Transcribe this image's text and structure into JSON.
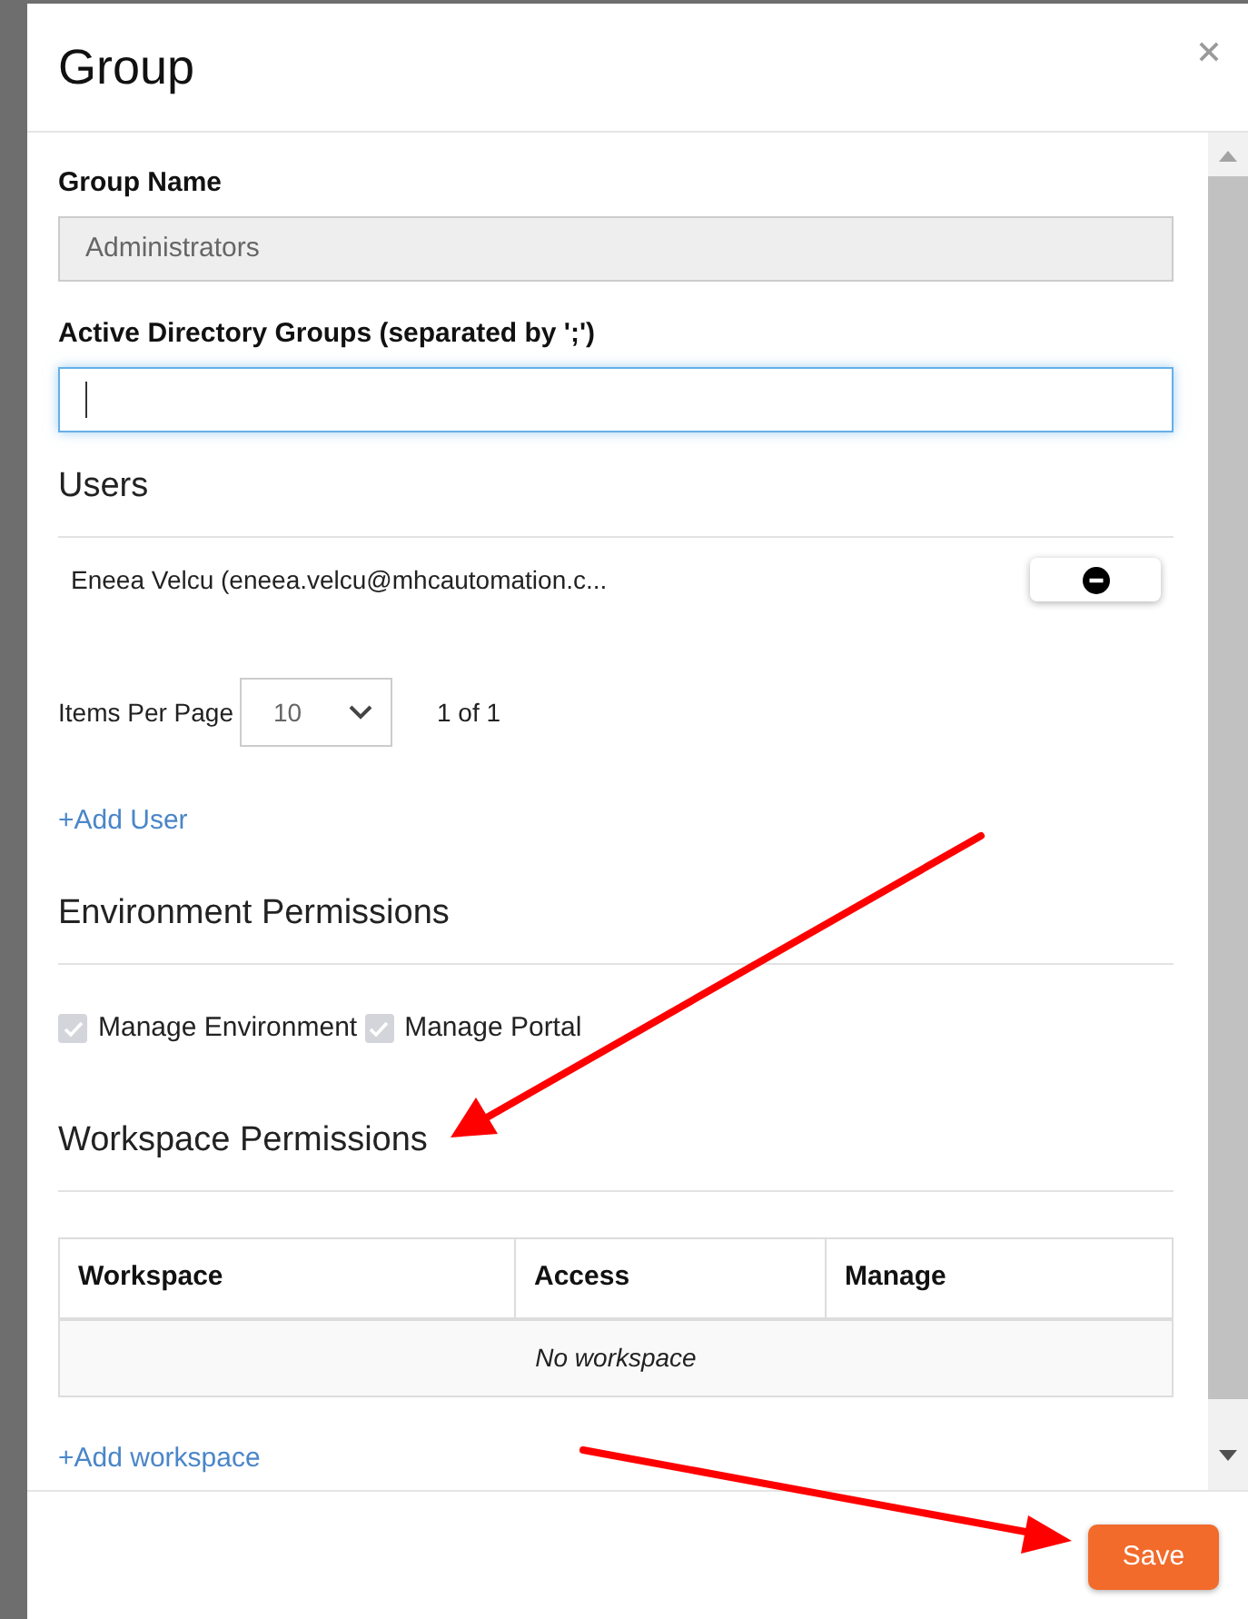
{
  "dialog": {
    "title": "Group"
  },
  "fields": [
    {
      "label": "Group Name",
      "value": "Administrators",
      "disabled": true,
      "focused": false
    },
    {
      "label": "Active Directory Groups (separated by ';')",
      "disabled": false,
      "focused": true
    }
  ],
  "users": {
    "heading": "Users",
    "rows": [
      {
        "name": "Eneea Velcu (eneea.velcu@mhcautomation.c..."
      }
    ],
    "items_per_page_label": "Items Per Page",
    "items_per_page": "10",
    "page_info": "1 of 1",
    "add_link": "+Add User"
  },
  "environment_permissions": {
    "heading": "Environment Permissions",
    "options": [
      {
        "label": "Manage Environment",
        "checked": true,
        "disabled": true
      },
      {
        "label": "Manage Portal",
        "checked": true,
        "disabled": true
      }
    ]
  },
  "workspace_permissions": {
    "heading": "Workspace Permissions",
    "table": {
      "columns": [
        "Workspace",
        "Access",
        "Manage"
      ],
      "empty_text": "No workspace"
    },
    "add_link": "+Add workspace"
  },
  "footer": {
    "save_button": "Save"
  }
}
